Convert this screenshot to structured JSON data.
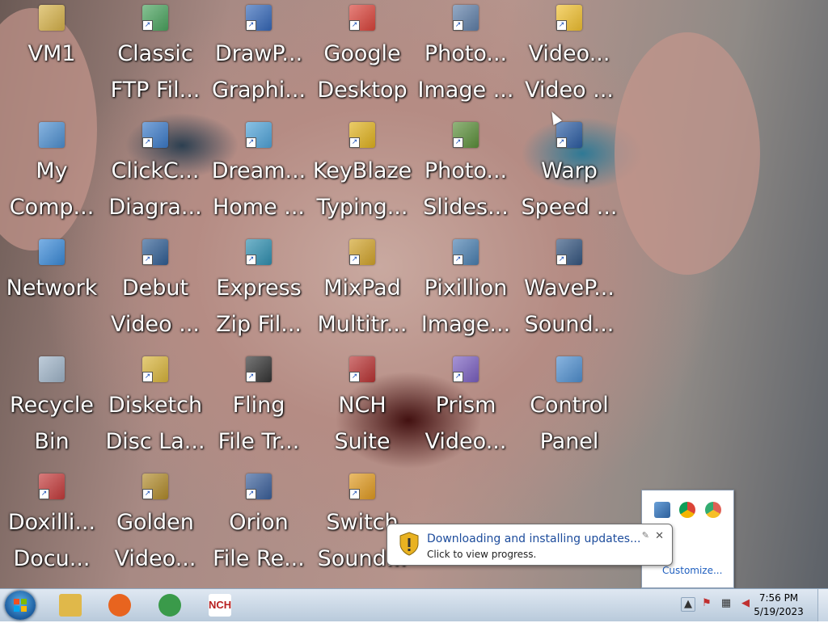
{
  "desktop": {
    "icons": [
      {
        "line1": "VM1",
        "line2": "",
        "icon": "user-folder-icon",
        "color": "#d6b24a"
      },
      {
        "line1": "Classic",
        "line2": "FTP Fil...",
        "icon": "ftp-icon",
        "color": "#4aa35e"
      },
      {
        "line1": "DrawP...",
        "line2": "Graphi...",
        "icon": "drawplus-icon",
        "color": "#3568b8"
      },
      {
        "line1": "Google",
        "line2": "Desktop",
        "icon": "google-desktop-icon",
        "color": "#d9433a"
      },
      {
        "line1": "Photo...",
        "line2": "Image ...",
        "icon": "photo-editor-icon",
        "color": "#5f7fa8"
      },
      {
        "line1": "Video...",
        "line2": "Video ...",
        "icon": "video-star-icon",
        "color": "#f0c030"
      },
      {
        "line1": "My",
        "line2": "Comp...",
        "icon": "computer-icon",
        "color": "#4d8fd0"
      },
      {
        "line1": "ClickC...",
        "line2": "Diagra...",
        "icon": "diagram-icon",
        "color": "#3b7ac8"
      },
      {
        "line1": "Dream...",
        "line2": "Home ...",
        "icon": "home-design-icon",
        "color": "#4fa3d8"
      },
      {
        "line1": "KeyBlaze",
        "line2": "Typing...",
        "icon": "keyboard-icon",
        "color": "#e0b21e"
      },
      {
        "line1": "Photo...",
        "line2": "Slides...",
        "icon": "slideshow-icon",
        "color": "#5b8f3a"
      },
      {
        "line1": "Warp",
        "line2": "Speed ...",
        "icon": "warp-speed-icon",
        "color": "#2c5da3"
      },
      {
        "line1": "Network",
        "line2": "",
        "icon": "network-icon",
        "color": "#3a8ad8"
      },
      {
        "line1": "Debut",
        "line2": "Video ...",
        "icon": "video-capture-icon",
        "color": "#2f5d93"
      },
      {
        "line1": "Express",
        "line2": "Zip Fil...",
        "icon": "zip-icon",
        "color": "#2f8fb0"
      },
      {
        "line1": "MixPad",
        "line2": "Multitr...",
        "icon": "mixpad-icon",
        "color": "#d1a32a"
      },
      {
        "line1": "Pixillion",
        "line2": "Image...",
        "icon": "image-converter-icon",
        "color": "#4a7fb0"
      },
      {
        "line1": "WaveP...",
        "line2": "Sound...",
        "icon": "waveform-icon",
        "color": "#34557f"
      },
      {
        "line1": "Recycle",
        "line2": "Bin",
        "icon": "recycle-bin-icon",
        "color": "#9fb4c8"
      },
      {
        "line1": "Disketch",
        "line2": "Disc La...",
        "icon": "disc-label-icon",
        "color": "#d8b43a"
      },
      {
        "line1": "Fling",
        "line2": "File Tr...",
        "icon": "file-transfer-icon",
        "color": "#333333"
      },
      {
        "line1": "NCH",
        "line2": "Suite",
        "icon": "nch-suite-icon",
        "color": "#b83232"
      },
      {
        "line1": "Prism",
        "line2": "Video...",
        "icon": "prism-icon",
        "color": "#7a5fc0"
      },
      {
        "line1": "Control",
        "line2": "Panel",
        "icon": "control-panel-icon",
        "color": "#4f8fcf"
      },
      {
        "line1": "Doxilli...",
        "line2": "Docu...",
        "icon": "document-converter-icon",
        "color": "#c33a3a"
      },
      {
        "line1": "Golden",
        "line2": "Video...",
        "icon": "golden-video-icon",
        "color": "#b08a2a"
      },
      {
        "line1": "Orion",
        "line2": "File Re...",
        "icon": "file-recovery-icon",
        "color": "#3a5f9a"
      },
      {
        "line1": "Switch",
        "line2": "Sound...",
        "icon": "audio-converter-icon",
        "color": "#e09a20"
      }
    ]
  },
  "balloon": {
    "title": "Downloading and installing updates...",
    "text": "Click to view progress."
  },
  "tray_popup": {
    "customize": "Customize..."
  },
  "taskbar": {
    "apps": [
      {
        "icon": "file-explorer-icon",
        "color": "#e0b84a"
      },
      {
        "icon": "firefox-icon",
        "color": "#e8641f"
      },
      {
        "icon": "chrome-icon",
        "color": "#3a9a4a"
      },
      {
        "icon": "nch-icon",
        "color": "#b82020"
      }
    ],
    "nch_label": "NCH",
    "time": "7:56 PM",
    "date": "5/19/2023"
  }
}
